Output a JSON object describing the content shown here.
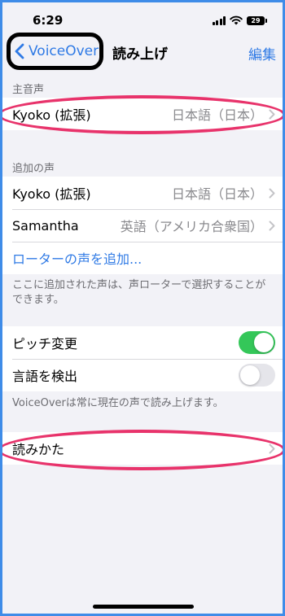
{
  "status_bar": {
    "time": "6:29",
    "battery": "29"
  },
  "nav": {
    "back_label": "VoiceOver",
    "title": "読み上げ",
    "edit_label": "編集"
  },
  "primary_voice": {
    "header": "主音声",
    "row": {
      "label": "Kyoko (拡張)",
      "value": "日本語（日本）"
    }
  },
  "additional_voices": {
    "header": "追加の声",
    "rows": [
      {
        "label": "Kyoko (拡張)",
        "value": "日本語（日本）"
      },
      {
        "label": "Samantha",
        "value": "英語（アメリカ合衆国）"
      }
    ],
    "add_link": "ローターの声を追加...",
    "footer": "ここに追加された声は、声ローターで選択することができます。"
  },
  "options": {
    "rows": [
      {
        "label": "ピッチ変更",
        "toggle": "on"
      },
      {
        "label": "言語を検出",
        "toggle": "off"
      }
    ],
    "footer": "VoiceOverは常に現在の声で読み上げます。"
  },
  "pronunciation": {
    "label": "読みかた"
  },
  "colors": {
    "accent": "#2f7ae5",
    "toggle_on": "#34c759",
    "annotation": "#e8336b",
    "frame": "#3f8ce8",
    "background": "#f2f2f7"
  },
  "icons": [
    "signal-icon",
    "wifi-icon",
    "battery-icon",
    "back-chevron-icon",
    "chevron-right-icon"
  ]
}
